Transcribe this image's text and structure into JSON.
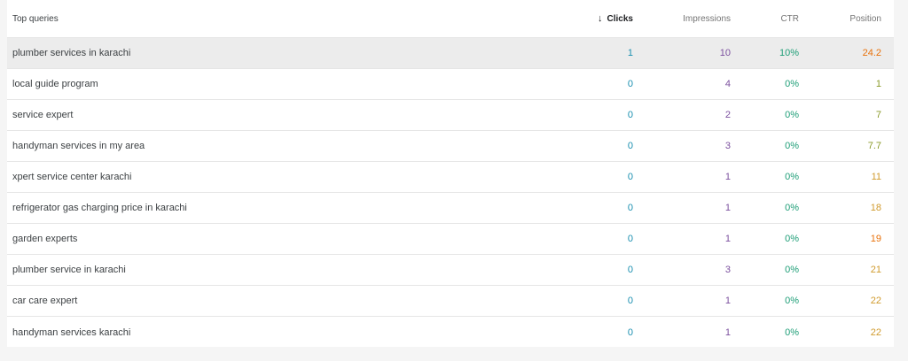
{
  "header": {
    "query_label": "Top queries",
    "clicks_label": "Clicks",
    "impressions_label": "Impressions",
    "ctr_label": "CTR",
    "position_label": "Position"
  },
  "colors": {
    "clicks": "#1a8fb0",
    "impressions": "#7b4f9e",
    "ctr": "#1e9e77",
    "position": "#e8710a"
  },
  "rows": [
    {
      "query": "plumber services in karachi",
      "clicks": "1",
      "impressions": "10",
      "ctr": "10%",
      "position": "24.2"
    },
    {
      "query": "local guide program",
      "clicks": "0",
      "impressions": "4",
      "ctr": "0%",
      "position": "1"
    },
    {
      "query": "service expert",
      "clicks": "0",
      "impressions": "2",
      "ctr": "0%",
      "position": "7"
    },
    {
      "query": "handyman services in my area",
      "clicks": "0",
      "impressions": "3",
      "ctr": "0%",
      "position": "7.7"
    },
    {
      "query": "xpert service center karachi",
      "clicks": "0",
      "impressions": "1",
      "ctr": "0%",
      "position": "11"
    },
    {
      "query": "refrigerator gas charging price in karachi",
      "clicks": "0",
      "impressions": "1",
      "ctr": "0%",
      "position": "18"
    },
    {
      "query": "garden experts",
      "clicks": "0",
      "impressions": "1",
      "ctr": "0%",
      "position": "19"
    },
    {
      "query": "plumber service in karachi",
      "clicks": "0",
      "impressions": "3",
      "ctr": "0%",
      "position": "21"
    },
    {
      "query": "car care expert",
      "clicks": "0",
      "impressions": "1",
      "ctr": "0%",
      "position": "22"
    },
    {
      "query": "handyman services karachi",
      "clicks": "0",
      "impressions": "1",
      "ctr": "0%",
      "position": "22"
    }
  ]
}
